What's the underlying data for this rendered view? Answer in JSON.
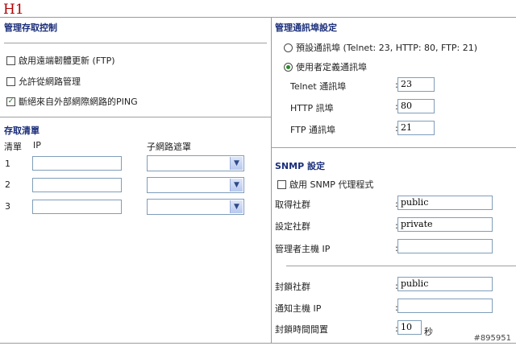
{
  "page_title": "H1",
  "left": {
    "mgmt_access_title": "管理存取控制",
    "options": [
      {
        "label": "啟用遠端韌體更新 (FTP)",
        "checked": false
      },
      {
        "label": "允許從網路管理",
        "checked": false
      },
      {
        "label": "斷絕來自外部網際網路的PING",
        "checked": true
      }
    ],
    "access_list_title": "存取清單",
    "headers": {
      "list": "清單",
      "ip": "IP",
      "mask": "子網路遮罩"
    },
    "rows": [
      {
        "num": "1",
        "ip": "",
        "mask": ""
      },
      {
        "num": "2",
        "ip": "",
        "mask": ""
      },
      {
        "num": "3",
        "ip": "",
        "mask": ""
      }
    ]
  },
  "right": {
    "port_title": "管理通訊埠設定",
    "radio_default": "預設通訊埠 (Telnet: 23, HTTP: 80, FTP: 21)",
    "radio_custom": "使用者定義通訊埠",
    "selected": "custom",
    "telnet_label": "Telnet 通訊埠",
    "telnet_value": "23",
    "http_label": "HTTP 訊埠",
    "http_value": "80",
    "ftp_label": "FTP 通訊埠",
    "ftp_value": "21",
    "snmp_title": "SNMP 設定",
    "snmp_enable": "啟用 SNMP 代理程式",
    "get_community_label": "取得社群",
    "get_community_value": "public",
    "set_community_label": "設定社群",
    "set_community_value": "private",
    "manager_ip_label": "管理者主機 IP",
    "manager_ip_value": "",
    "trap_community_label": "封鎖社群",
    "trap_community_value": "public",
    "notify_ip_label": "通知主機 IP",
    "notify_ip_value": "",
    "trap_interval_label": "封鎖時間間置",
    "trap_interval_value": "10",
    "trap_interval_unit": "秒"
  },
  "watermark": "#895951"
}
